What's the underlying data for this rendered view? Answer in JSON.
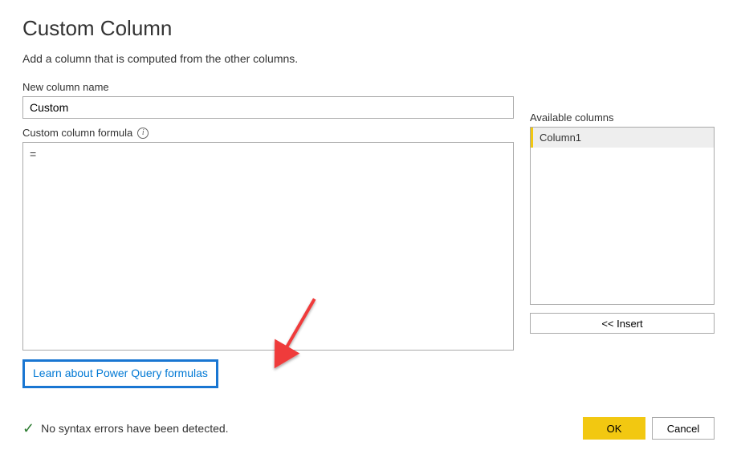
{
  "dialog": {
    "title": "Custom Column",
    "description": "Add a column that is computed from the other columns."
  },
  "left": {
    "name_label": "New column name",
    "name_value": "Custom",
    "formula_label": "Custom column formula",
    "formula_value": "=",
    "learn_link": "Learn about Power Query formulas"
  },
  "right": {
    "available_label": "Available columns",
    "columns": [
      "Column1"
    ],
    "insert_label": "<< Insert"
  },
  "status": {
    "message": "No syntax errors have been detected."
  },
  "buttons": {
    "ok": "OK",
    "cancel": "Cancel"
  }
}
